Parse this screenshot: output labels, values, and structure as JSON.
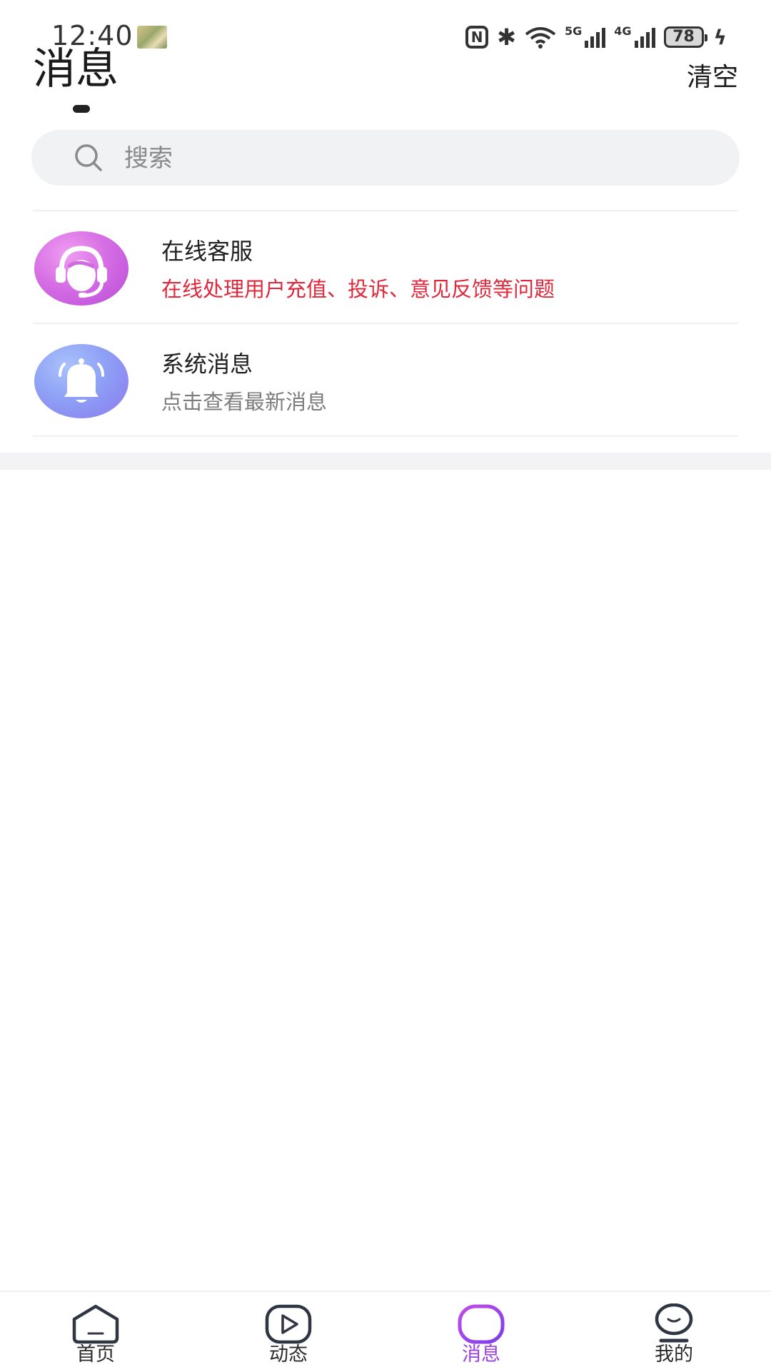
{
  "status_bar": {
    "time": "12:40",
    "network_5g": "5G",
    "network_4g": "4G",
    "battery": "78"
  },
  "header": {
    "title": "消息",
    "clear_label": "清空"
  },
  "search": {
    "placeholder": "搜索"
  },
  "messages": [
    {
      "title": "在线客服",
      "subtitle": "在线处理用户充值、投诉、意见反馈等问题",
      "icon": "customer-service-headset-icon",
      "subtitle_color": "#e0283c"
    },
    {
      "title": "系统消息",
      "subtitle": "点击查看最新消息",
      "icon": "bell-icon",
      "subtitle_color": "#7c7c7c"
    }
  ],
  "tab_bar": {
    "active_color": "#9b3fe6",
    "items": [
      {
        "label": "首页",
        "icon": "home-icon"
      },
      {
        "label": "动态",
        "icon": "play-icon"
      },
      {
        "label": "消息",
        "icon": "message-icon",
        "active": true
      },
      {
        "label": "我的",
        "icon": "profile-icon"
      }
    ]
  }
}
